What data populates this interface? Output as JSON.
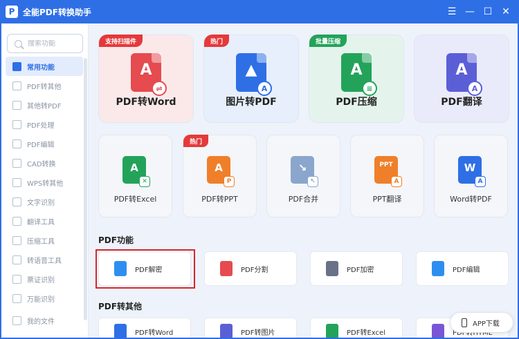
{
  "app": {
    "title": "全能PDF转换助手",
    "logo_letter": "P"
  },
  "window_controls": [
    "☰",
    "—",
    "☐",
    "✕"
  ],
  "search": {
    "placeholder": "搜索功能"
  },
  "sidebar": {
    "items": [
      {
        "label": "常用功能",
        "active": true
      },
      {
        "label": "PDF转其他"
      },
      {
        "label": "其他转PDF"
      },
      {
        "label": "PDF处理"
      },
      {
        "label": "PDF编辑"
      },
      {
        "label": "CAD转换"
      },
      {
        "label": "WPS转其他"
      },
      {
        "label": "文字识别"
      },
      {
        "label": "翻译工具"
      },
      {
        "label": "压缩工具"
      },
      {
        "label": "转语音工具"
      },
      {
        "label": "票证识别"
      },
      {
        "label": "万能识别"
      }
    ],
    "bottom": {
      "label": "我的文件"
    }
  },
  "big_cards": [
    {
      "label": "PDF转Word",
      "tag": "支持扫描件",
      "tag_color": "#e5393b",
      "bg": "#fbe9ea",
      "icon_color": "#e54b4f",
      "glyph": "A",
      "badge": "⇌"
    },
    {
      "label": "图片转PDF",
      "tag": "热门",
      "tag_color": "#e5393b",
      "bg": "#e7effc",
      "icon_color": "#2e6fe6",
      "glyph": "▲",
      "badge": "A"
    },
    {
      "label": "PDF压缩",
      "tag": "批量压缩",
      "tag_color": "#23a35a",
      "bg": "#e4f4ec",
      "icon_color": "#23a35a",
      "glyph": "A",
      "badge": "≡"
    },
    {
      "label": "PDF翻译",
      "tag": "",
      "tag_color": "",
      "bg": "#eaebfa",
      "icon_color": "#5b5fd6",
      "glyph": "A",
      "badge": "A"
    }
  ],
  "small_cards": [
    {
      "label": "PDF转Excel",
      "tag": "",
      "icon_color": "#23a35a",
      "glyph": "A",
      "badge": "✕"
    },
    {
      "label": "PDF转PPT",
      "tag": "热门",
      "icon_color": "#f07f2a",
      "glyph": "A",
      "badge": "P"
    },
    {
      "label": "PDF合并",
      "tag": "",
      "icon_color": "#8aa6cc",
      "glyph": "↘",
      "badge": "↖"
    },
    {
      "label": "PPT翻译",
      "tag": "",
      "icon_color": "#f07f2a",
      "glyph": "PPT",
      "badge": "A"
    },
    {
      "label": "Word转PDF",
      "tag": "",
      "icon_color": "#2e6fe6",
      "glyph": "W",
      "badge": "A"
    }
  ],
  "sections": {
    "pdf_functions": "PDF功能",
    "pdf_to_other": "PDF转其他"
  },
  "function_cards": [
    {
      "label": "PDF解密",
      "icon_color": "#2e8ef0"
    },
    {
      "label": "PDF分割",
      "icon_color": "#e54b4f"
    },
    {
      "label": "PDF加密",
      "icon_color": "#6a7288"
    },
    {
      "label": "PDF编辑",
      "icon_color": "#2e8ef0"
    }
  ],
  "convert_cards": [
    {
      "label": "PDF转Word",
      "icon_color": "#2e6fe6"
    },
    {
      "label": "PDF转图片",
      "icon_color": "#5b5fd6"
    },
    {
      "label": "PDF转Excel",
      "icon_color": "#23a35a"
    },
    {
      "label": "PDF转HTML",
      "icon_color": "#7a55d6"
    }
  ],
  "app_download": {
    "label": "APP下载"
  }
}
